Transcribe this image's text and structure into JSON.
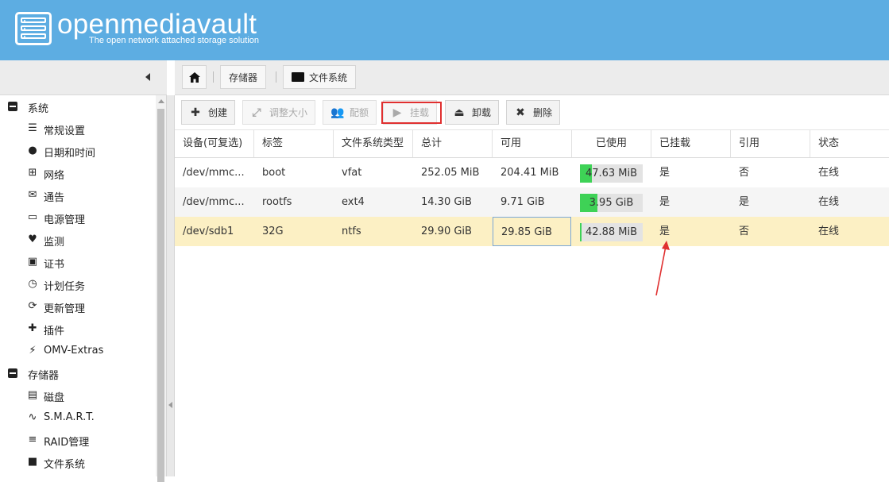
{
  "header": {
    "brand": "openmediavault",
    "tagline": "The open network attached storage solution"
  },
  "breadcrumb": {
    "items": [
      "存储器",
      "文件系统"
    ]
  },
  "sidebar": {
    "groups": [
      {
        "label": "系统",
        "items": [
          {
            "label": "常规设置",
            "icon": "sliders-icon"
          },
          {
            "label": "日期和时间",
            "icon": "clock-icon"
          },
          {
            "label": "网络",
            "icon": "network-icon"
          },
          {
            "label": "通告",
            "icon": "envelope-icon"
          },
          {
            "label": "电源管理",
            "icon": "battery-icon"
          },
          {
            "label": "监测",
            "icon": "heartbeat-icon"
          },
          {
            "label": "证书",
            "icon": "certificate-icon"
          },
          {
            "label": "计划任务",
            "icon": "calendar-clock-icon"
          },
          {
            "label": "更新管理",
            "icon": "refresh-icon"
          },
          {
            "label": "插件",
            "icon": "puzzle-icon"
          },
          {
            "label": "OMV-Extras",
            "icon": "plug-icon"
          }
        ]
      },
      {
        "label": "存储器",
        "items": [
          {
            "label": "磁盘",
            "icon": "harddisk-icon"
          },
          {
            "label": "S.M.A.R.T.",
            "icon": "pulse-icon"
          },
          {
            "label": "RAID管理",
            "icon": "database-icon"
          },
          {
            "label": "文件系统",
            "icon": "folder-icon"
          }
        ]
      }
    ]
  },
  "toolbar": {
    "create": "创建",
    "resize": "调整大小",
    "quota": "配额",
    "mount": "挂载",
    "unmount": "卸载",
    "delete": "删除"
  },
  "grid": {
    "columns": [
      "设备(可复选)",
      "标签",
      "文件系统类型",
      "总计",
      "可用",
      "已使用",
      "已挂载",
      "引用",
      "状态"
    ],
    "rows": [
      {
        "device": "/dev/mmc...",
        "label": "boot",
        "type": "vfat",
        "total": "252.05 MiB",
        "available": "204.41 MiB",
        "used": "47.63 MiB",
        "used_fraction": 0.19,
        "mounted": "是",
        "referenced": "否",
        "status": "在线"
      },
      {
        "device": "/dev/mmc...",
        "label": "rootfs",
        "type": "ext4",
        "total": "14.30 GiB",
        "available": "9.71 GiB",
        "used": "3.95 GiB",
        "used_fraction": 0.28,
        "mounted": "是",
        "referenced": "是",
        "status": "在线"
      },
      {
        "device": "/dev/sdb1",
        "label": "32G",
        "type": "ntfs",
        "total": "29.90 GiB",
        "available": "29.85 GiB",
        "used": "42.88 MiB",
        "used_fraction": 0.01,
        "mounted": "是",
        "referenced": "否",
        "status": "在线"
      }
    ]
  },
  "colors": {
    "header": "#5dade2",
    "usage_fill": "#3ed256",
    "selected_row": "#fcf0c4",
    "annotation": "#e03030"
  }
}
